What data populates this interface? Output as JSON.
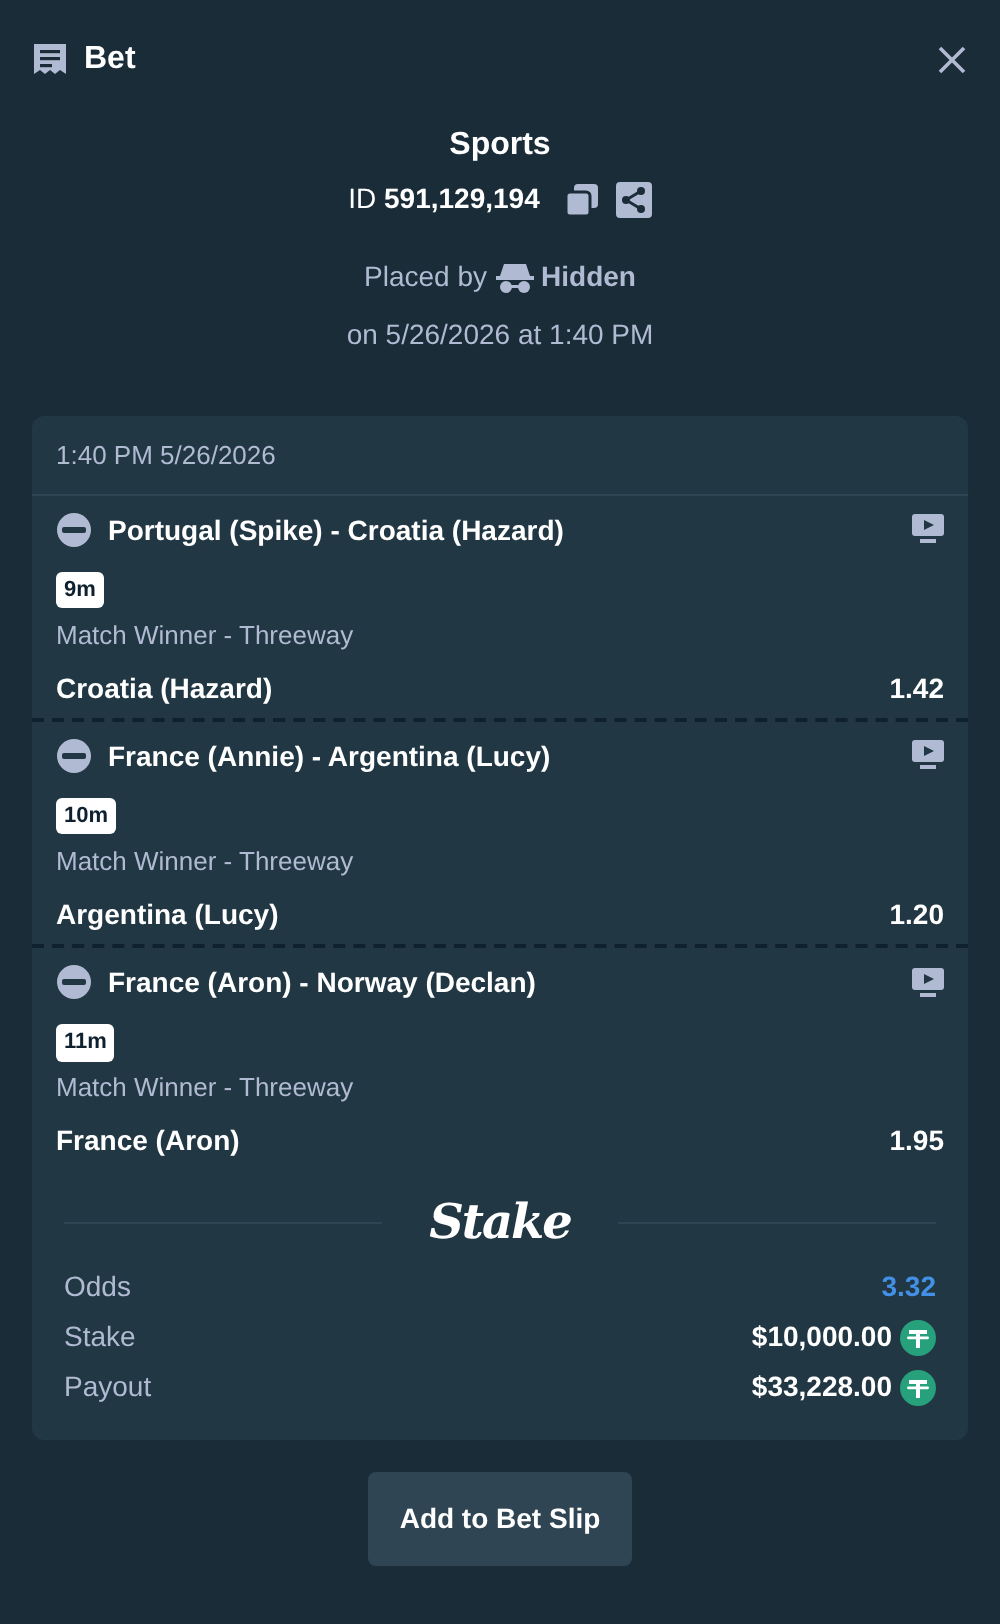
{
  "header": {
    "title": "Bet"
  },
  "summary": {
    "title": "Sports",
    "id_label": "ID",
    "id_value": "591,129,194",
    "placed_by_label": "Placed by",
    "placed_by_user": "Hidden",
    "placed_on": "on 5/26/2026 at 1:40 PM"
  },
  "slip": {
    "timestamp": "1:40 PM 5/26/2026",
    "legs": [
      {
        "event": "Portugal (Spike) - Croatia (Hazard)",
        "time": "9m",
        "market": "Match Winner - Threeway",
        "selection": "Croatia (Hazard)",
        "odds": "1.42"
      },
      {
        "event": "France (Annie) - Argentina (Lucy)",
        "time": "10m",
        "market": "Match Winner - Threeway",
        "selection": "Argentina (Lucy)",
        "odds": "1.20"
      },
      {
        "event": "France (Aron) - Norway (Declan)",
        "time": "11m",
        "market": "Match Winner - Threeway",
        "selection": "France (Aron)",
        "odds": "1.95"
      }
    ],
    "logo": "Stake",
    "totals": [
      {
        "kind": "odds",
        "label": "Odds",
        "value": "3.32"
      },
      {
        "kind": "amount",
        "label": "Stake",
        "value": "$10,000.00"
      },
      {
        "kind": "amount",
        "label": "Payout",
        "value": "$33,228.00"
      }
    ]
  },
  "action": {
    "label": "Add to Bet Slip"
  }
}
